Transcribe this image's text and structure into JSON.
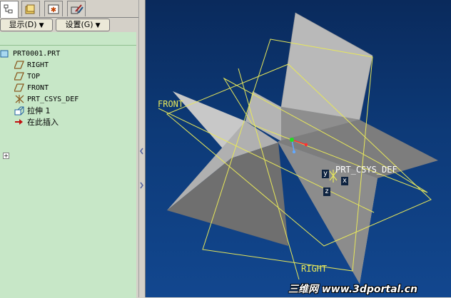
{
  "toolbar": {
    "show_label": "显示(D)",
    "settings_label": "设置(G)",
    "dropdown_icon": "chevron-down-icon"
  },
  "tabs": [
    {
      "name": "model-tree-tab",
      "icon": "tree-icon",
      "active": true
    },
    {
      "name": "folder-browser-tab",
      "icon": "folder-icon"
    },
    {
      "name": "favorites-tab",
      "icon": "star-icon"
    },
    {
      "name": "connections-tab",
      "icon": "tools-icon"
    }
  ],
  "tree": {
    "items": [
      {
        "label": "PRT0001.PRT",
        "icon": "part-icon"
      },
      {
        "label": "RIGHT",
        "icon": "datum-plane-icon"
      },
      {
        "label": "TOP",
        "icon": "datum-plane-icon"
      },
      {
        "label": "FRONT",
        "icon": "datum-plane-icon"
      },
      {
        "label": "PRT_CSYS_DEF",
        "icon": "coordinate-system-icon"
      },
      {
        "label": "拉伸 1",
        "icon": "extrude-icon",
        "expander": "+"
      },
      {
        "label": "在此插入",
        "icon": "insert-here-arrow-icon"
      }
    ]
  },
  "viewport": {
    "datum_labels": {
      "front": "FRONT",
      "right": "RIGHT",
      "csys": "PRT_CSYS_DEF"
    },
    "axes": {
      "x": "x",
      "y": "y",
      "z": "z"
    },
    "datum_color": "#e8e85a",
    "watermark": "三维网 www.3dportal.cn"
  }
}
